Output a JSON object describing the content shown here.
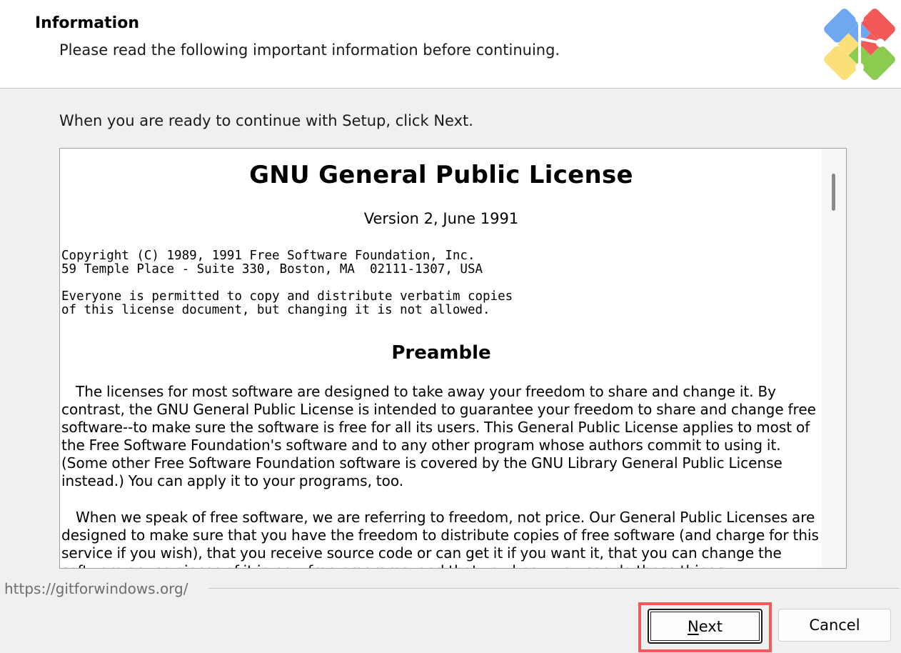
{
  "header": {
    "title": "Information",
    "subtitle": "Please read the following important information before continuing."
  },
  "intro_text": "When you are ready to continue with Setup, click Next.",
  "license": {
    "title": "GNU General Public License",
    "version": "Version 2, June 1991",
    "copyright_lines": [
      "Copyright (C) 1989, 1991 Free Software Foundation, Inc.",
      "59 Temple Place - Suite 330, Boston, MA  02111-1307, USA"
    ],
    "notice_lines": [
      "Everyone is permitted to copy and distribute verbatim copies",
      "of this license document, but changing it is not allowed."
    ],
    "preamble_heading": "Preamble",
    "paragraphs": [
      "The licenses for most software are designed to take away your freedom to share and change it. By contrast, the GNU General Public License is intended to guarantee your freedom to share and change free software--to make sure the software is free for all its users. This General Public License applies to most of the Free Software Foundation's software and to any other program whose authors commit to using it. (Some other Free Software Foundation software is covered by the GNU Library General Public License instead.) You can apply it to your programs, too.",
      "When we speak of free software, we are referring to freedom, not price. Our General Public Licenses are designed to make sure that you have the freedom to distribute copies of free software (and charge for this service if you wish), that you receive source code or can get it if you want it, that you can change the software or use pieces of it in new free programs; and that you know you can do these things."
    ]
  },
  "footer": {
    "link": "https://gitforwindows.org/"
  },
  "buttons": {
    "next_mnemonic": "N",
    "next_rest": "ext",
    "cancel": "Cancel"
  },
  "colors": {
    "highlight": "#f05a5a",
    "logo_red": "#f25a5a",
    "logo_green": "#8bcb4f",
    "logo_blue": "#6fa8f0",
    "logo_yellow": "#fbe07a"
  },
  "icons": {
    "logo": "git-for-windows-logo-icon"
  }
}
